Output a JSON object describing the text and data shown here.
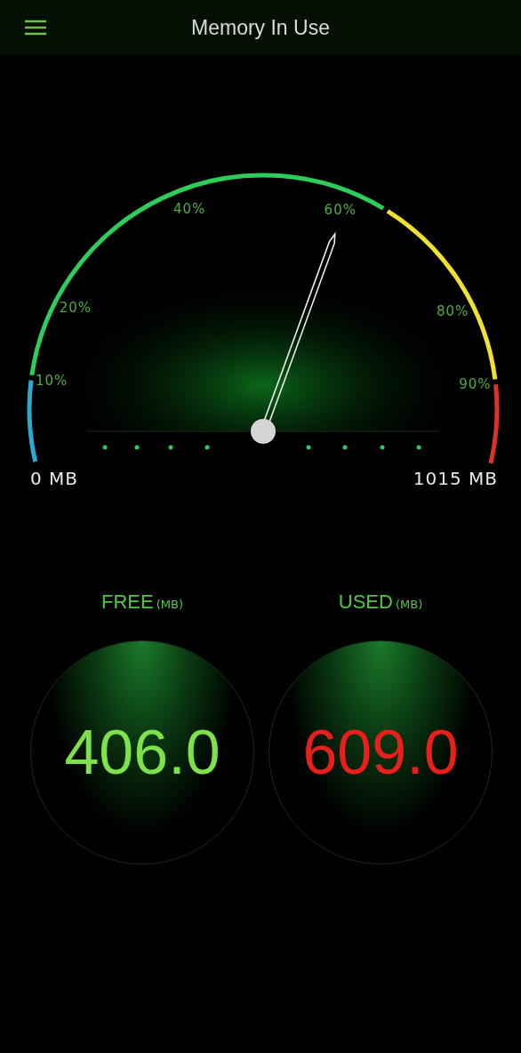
{
  "header": {
    "title": "Memory In Use"
  },
  "gauge": {
    "min_label": "0 MB",
    "max_label": "1015 MB",
    "segments": [
      {
        "color": "#2aa9d2"
      },
      {
        "color": "#2ecc5a"
      },
      {
        "color": "#f0e032"
      },
      {
        "color": "#d8342c"
      }
    ],
    "ticks": [
      {
        "label": "10%"
      },
      {
        "label": "20%"
      },
      {
        "label": "40%"
      },
      {
        "label": "60%"
      },
      {
        "label": "80%"
      },
      {
        "label": "90%"
      }
    ]
  },
  "stats": [
    {
      "label": "FREE",
      "unit": "(MB)",
      "value": "406.0",
      "color": "#7ee04a"
    },
    {
      "label": "USED",
      "unit": "(MB)",
      "value": "609.0",
      "color": "#e8201c"
    }
  ]
}
